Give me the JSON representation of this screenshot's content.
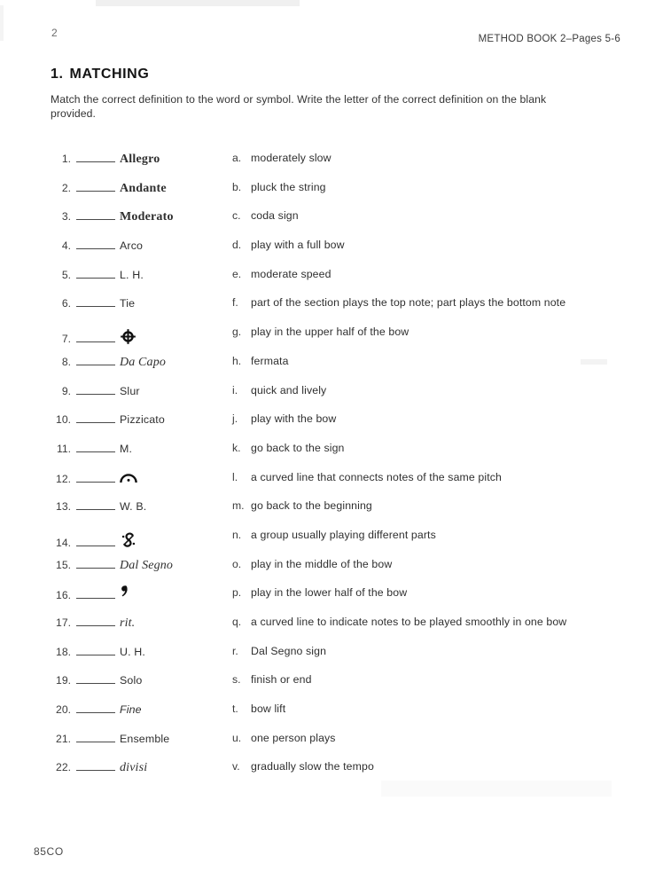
{
  "header": {
    "page_number": "2",
    "book_reference": "METHOD BOOK 2–Pages 5-6"
  },
  "section": {
    "number": "1.",
    "title": "MATCHING",
    "instructions": "Match the correct definition to the word or symbol. Write the letter of the correct definition on the blank provided."
  },
  "terms": [
    {
      "number": "1",
      "label": "Allegro",
      "style": "serif-bold"
    },
    {
      "number": "2",
      "label": "Andante",
      "style": "serif-bold"
    },
    {
      "number": "3",
      "label": "Moderato",
      "style": "serif-bold"
    },
    {
      "number": "4",
      "label": "Arco",
      "style": "sans"
    },
    {
      "number": "5",
      "label": "L. H.",
      "style": "sans"
    },
    {
      "number": "6",
      "label": "Tie",
      "style": "sans"
    },
    {
      "number": "7",
      "label": "",
      "style": "symbol",
      "icon": "coda-icon"
    },
    {
      "number": "8",
      "label": "Da Capo",
      "style": "serif-italic"
    },
    {
      "number": "9",
      "label": "Slur",
      "style": "sans"
    },
    {
      "number": "10",
      "label": "Pizzicato",
      "style": "sans"
    },
    {
      "number": "11",
      "label": "M.",
      "style": "sans"
    },
    {
      "number": "12",
      "label": "",
      "style": "symbol",
      "icon": "fermata-icon"
    },
    {
      "number": "13",
      "label": "W. B.",
      "style": "sans"
    },
    {
      "number": "14",
      "label": "",
      "style": "symbol",
      "icon": "segno-icon"
    },
    {
      "number": "15",
      "label": "Dal Segno",
      "style": "serif-italic"
    },
    {
      "number": "16",
      "label": "",
      "style": "symbol",
      "icon": "breath-mark-icon"
    },
    {
      "number": "17",
      "label": "rit.",
      "style": "serif-italic"
    },
    {
      "number": "18",
      "label": "U. H.",
      "style": "sans"
    },
    {
      "number": "19",
      "label": "Solo",
      "style": "sans"
    },
    {
      "number": "20",
      "label": "Fine",
      "style": "sans-italic"
    },
    {
      "number": "21",
      "label": "Ensemble",
      "style": "sans"
    },
    {
      "number": "22",
      "label": "divisi",
      "style": "serif-italic"
    }
  ],
  "definitions": [
    {
      "letter": "a",
      "text": "moderately slow"
    },
    {
      "letter": "b",
      "text": "pluck the string"
    },
    {
      "letter": "c",
      "text": "coda sign"
    },
    {
      "letter": "d",
      "text": "play with a full bow"
    },
    {
      "letter": "e",
      "text": "moderate speed"
    },
    {
      "letter": "f",
      "text": "part of the section plays the top note; part plays the bottom note"
    },
    {
      "letter": "g",
      "text": "play in the upper half of the bow"
    },
    {
      "letter": "h",
      "text": "fermata"
    },
    {
      "letter": "i",
      "text": "quick and lively"
    },
    {
      "letter": "j",
      "text": "play with the bow"
    },
    {
      "letter": "k",
      "text": "go back to the sign"
    },
    {
      "letter": "l",
      "text": "a curved line that connects notes of the same pitch"
    },
    {
      "letter": "m",
      "text": "go back to the beginning"
    },
    {
      "letter": "n",
      "text": "a group usually playing different parts"
    },
    {
      "letter": "o",
      "text": "play in the middle of the bow"
    },
    {
      "letter": "p",
      "text": "play in the lower half of the bow"
    },
    {
      "letter": "q",
      "text": "a curved line to indicate notes to be played smoothly in one bow"
    },
    {
      "letter": "r",
      "text": "Dal Segno sign"
    },
    {
      "letter": "s",
      "text": "finish or end"
    },
    {
      "letter": "t",
      "text": "bow lift"
    },
    {
      "letter": "u",
      "text": "one person plays"
    },
    {
      "letter": "v",
      "text": "gradually slow the tempo"
    }
  ],
  "footer": {
    "code": "85CO"
  },
  "colors": {
    "ink": "#2a2a2a",
    "paper": "#ffffff",
    "rule": "#4a4a4a"
  }
}
